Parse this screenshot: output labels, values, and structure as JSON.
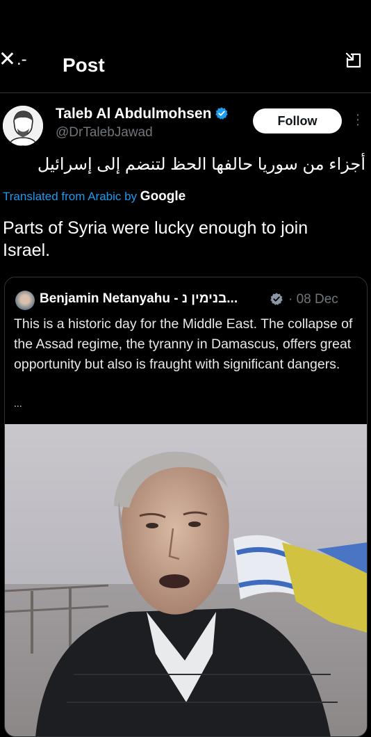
{
  "header": {
    "title": "Post",
    "dash": ".-"
  },
  "author": {
    "name": "Taleb Al Abdulmohsen",
    "handle": "@DrTalebJawad",
    "follow_label": "Follow"
  },
  "post": {
    "original_text": "أجزاء من سوريا حالفها الحظ لتنضم إلى إسرائيل",
    "translated_from": "Translated from Arabic by",
    "translator": "Google",
    "translation": "Parts of Syria were lucky enough to join Israel."
  },
  "quoted_post": {
    "author_name": "Benjamin Netanyahu - בנימין נ...",
    "date": "· 08 Dec",
    "text": "This is a historic day for the Middle East. The collapse of the Assad regime, the tyranny in Damascus, offers great opportunity but also is fraught with significant dangers.",
    "ellipsis": "..."
  },
  "colors": {
    "link": "#1d9bf0",
    "verified": "#1d9bf0",
    "muted": "#71767b",
    "border": "#2f3336"
  }
}
